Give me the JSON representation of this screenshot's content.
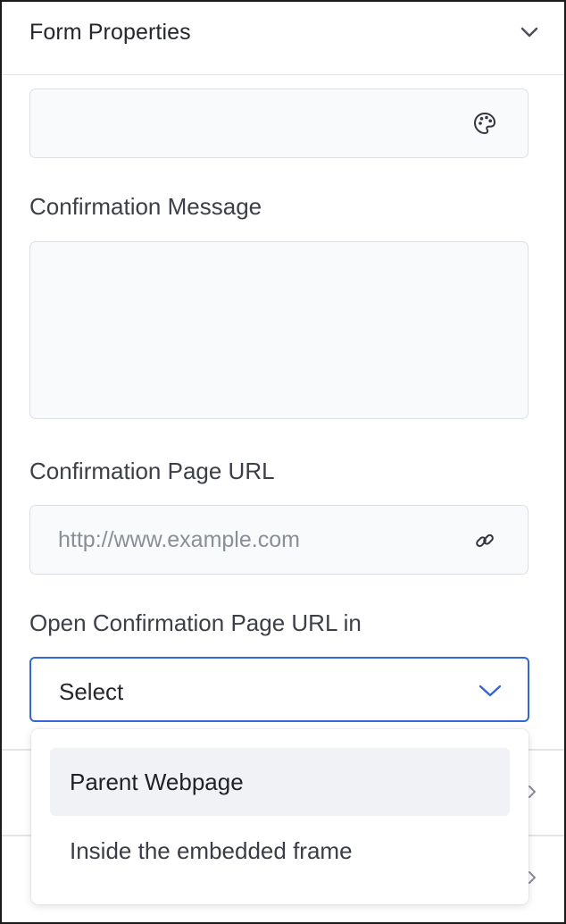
{
  "header": {
    "title": "Form Properties",
    "chevron_icon": "chevron-down-icon"
  },
  "color_field": {
    "icon": "palette-icon"
  },
  "confirmation_message": {
    "label": "Confirmation Message",
    "value": ""
  },
  "confirmation_url": {
    "label": "Confirmation Page URL",
    "placeholder": "http://www.example.com",
    "icon": "link-icon"
  },
  "open_in": {
    "label": "Open Confirmation Page URL in",
    "selected": "Select",
    "options": [
      "Parent Webpage",
      "Inside the embedded frame"
    ],
    "highlighted_index": 0
  },
  "colors": {
    "accent": "#3366d6",
    "field_bg": "#f9fafc",
    "border": "#dcdfe4",
    "text": "#33363f"
  }
}
